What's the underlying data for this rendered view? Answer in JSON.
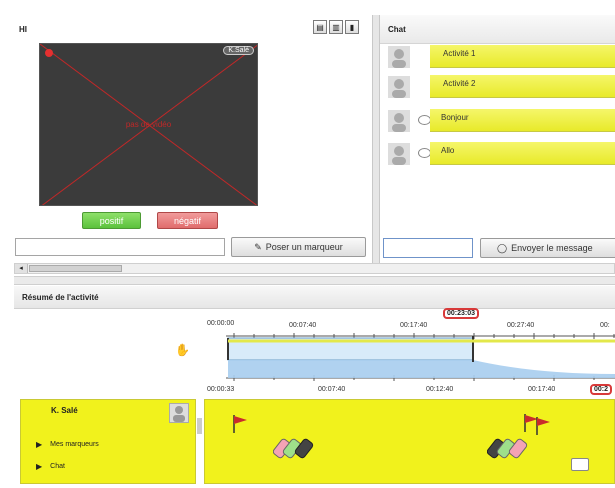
{
  "video": {
    "title": "HI",
    "user_tag": "K.Salé",
    "center_label": "pas de vidéo",
    "positive_label": "positif",
    "negative_label": "négatif",
    "marker_input_value": "",
    "marker_button_label": "Poser un marqueur"
  },
  "chat": {
    "title": "Chat",
    "messages": [
      {
        "text": "Activité 1",
        "has_bubble_icon": false
      },
      {
        "text": "Activité 2",
        "has_bubble_icon": false
      },
      {
        "text": "Bonjour",
        "has_bubble_icon": true
      },
      {
        "text": "Allo",
        "has_bubble_icon": true
      }
    ],
    "input_value": "",
    "send_button_label": "Envoyer le message"
  },
  "summary": {
    "title": "Résumé de l'activité",
    "top_ruler_labels": [
      "00:00:00",
      "00:07:40",
      "00:17:40",
      "00:27:40",
      "00:"
    ],
    "bottom_ruler_labels": [
      "00:00:33",
      "00:07:40",
      "00:12:40",
      "00:17:40"
    ],
    "cursor_time_top": "00:23:03",
    "cursor_time_bottom": "00:2",
    "user_panel": {
      "name": "K. Salé",
      "items": [
        "Mes marqueurs",
        "Chat"
      ]
    }
  },
  "colors": {
    "yellow": "#f1f21c",
    "red": "#d83a3a",
    "blue": "#a7cdee"
  }
}
